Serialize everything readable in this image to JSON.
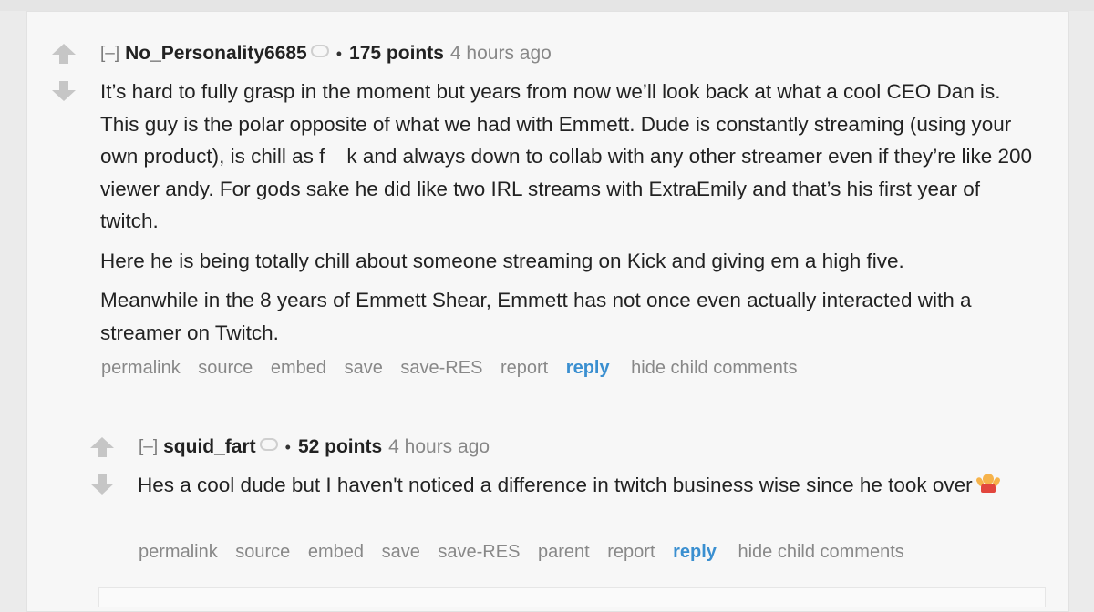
{
  "comment1": {
    "expand": "[–]",
    "author": "No_Personality6685",
    "score": "175 points",
    "time": "4 hours ago",
    "para1_before": "It’s hard to fully grasp in the moment but years from now we’ll look back at what a cool CEO Dan is. This guy is the polar opposite of what we had with Emmett. Dude is constantly streaming (using your own product), is chill as f",
    "para1_after": "k and always down to collab with any other streamer even if they’re like 200 viewer andy. For gods sake he did like two IRL streams with ExtraEmily and that’s his first year of twitch.",
    "para2": "Here he is being totally chill about someone streaming on Kick and giving em a high five.",
    "para3": "Meanwhile in the 8 years of Emmett Shear, Emmett has not once even actually interacted with a streamer on Twitch.",
    "buttons": {
      "permalink": "permalink",
      "source": "source",
      "embed": "embed",
      "save": "save",
      "save_res": "save-RES",
      "report": "report",
      "reply": "reply",
      "hide": "hide child comments"
    }
  },
  "comment2": {
    "expand": "[–]",
    "author": "squid_fart",
    "score": "52 points",
    "time": "4 hours ago",
    "para1": "Hes a cool dude but I haven't noticed a difference in twitch business wise since he took over",
    "emoji_icon": "person-shrugging-icon",
    "buttons": {
      "permalink": "permalink",
      "source": "source",
      "embed": "embed",
      "save": "save",
      "save_res": "save-RES",
      "parent": "parent",
      "report": "report",
      "reply": "reply",
      "hide": "hide child comments"
    }
  },
  "colors": {
    "link_blue": "#3a8fd0",
    "arrow_gray": "#c6c6c6",
    "meta_gray": "#888888"
  }
}
